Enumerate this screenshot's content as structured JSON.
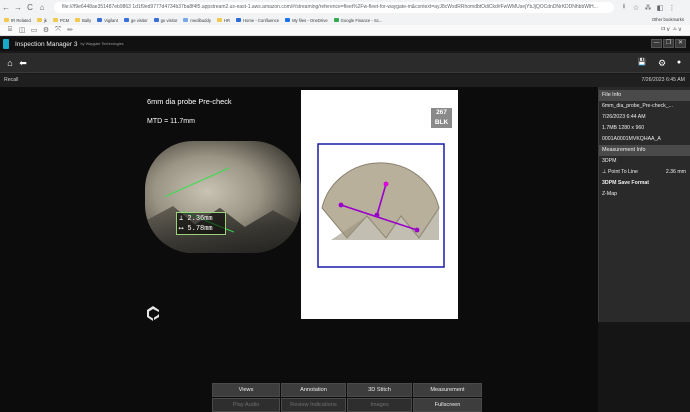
{
  "browser": {
    "nav_icons": [
      "←",
      "→",
      "C",
      "⌂"
    ],
    "url": "file:///f9e6448ae351487eb9863 1d1f9ed9777d4734b37ba8f4f5.appstream2.us-east-1.aws.amazon.com/#/streaming/reference=fleet%2Fw-fleet-for-waygate-m&context=ayJ8cWxdRRhomdbtOdiCkd#FwWMUsejYbJjQOCdnDNrKDDNhbbWlH...",
    "right_icons": [
      "⭳",
      "☆",
      "⁂",
      "◧",
      "⋮"
    ],
    "bookmarks": [
      "IR Related",
      "jk",
      "PCM",
      "Bally",
      "Vigilant",
      "ge visitor",
      "ge visitor",
      "medibuddy",
      "HR",
      "Home - Confluence",
      "My files - OneDrive",
      "Google Finance - Sc..."
    ],
    "other_bookmarks": "Other bookmarks",
    "toolbar_icons": [
      "⌸",
      "◫",
      "▭",
      "⚙",
      "⤧",
      "✏"
    ],
    "toolbar_right": "ㅁ∨  ㅅ∨"
  },
  "app": {
    "title": "Inspection Manager 3",
    "subtitle": "by Waygate Technologies",
    "window_buttons": [
      "—",
      "❐",
      "✕"
    ]
  },
  "appbar": {
    "home": "⌂",
    "back": "⬅",
    "save": "💾",
    "settings": "⚙",
    "info": "●"
  },
  "status": {
    "left": "Recall",
    "datetime": "7/26/2023 6:45 AM"
  },
  "viewer": {
    "title": "6mm dia probe Pre-check",
    "mtd": "MTD = 11.7mm",
    "measure_1": "⊥ 2.36mm",
    "measure_2": "⟷ 5.78mm",
    "page_number": "267",
    "page_label": "BLK"
  },
  "side_panel": {
    "file_header": "File Info",
    "file_rows": [
      "6mm_dia_probe_Pre-check_...",
      "7/26/2023 6:44 AM",
      "1.7MB 1280 x 960",
      "0001A0001MVKQHAA_A"
    ],
    "measurement_header": "Measurement Info",
    "mode": "3DPM",
    "point_to_line_label": "⊥ Point To Line",
    "point_to_line_value": "2.36 mm",
    "format": "3DPM Save Format",
    "zmap": "Z-Map"
  },
  "bottom_buttons": {
    "row1": [
      "Views",
      "Annotation",
      "3D Stitch",
      "Measurement"
    ],
    "row2": [
      "Play Audio",
      "Review Indications",
      "Images",
      "Fullscreen"
    ]
  },
  "colors": {
    "accent": "#18a8c8",
    "panel": "#2a2a2a",
    "header": "#4a4a4a",
    "measure_line": "#9900cc",
    "frame": "#1a1aa8"
  }
}
